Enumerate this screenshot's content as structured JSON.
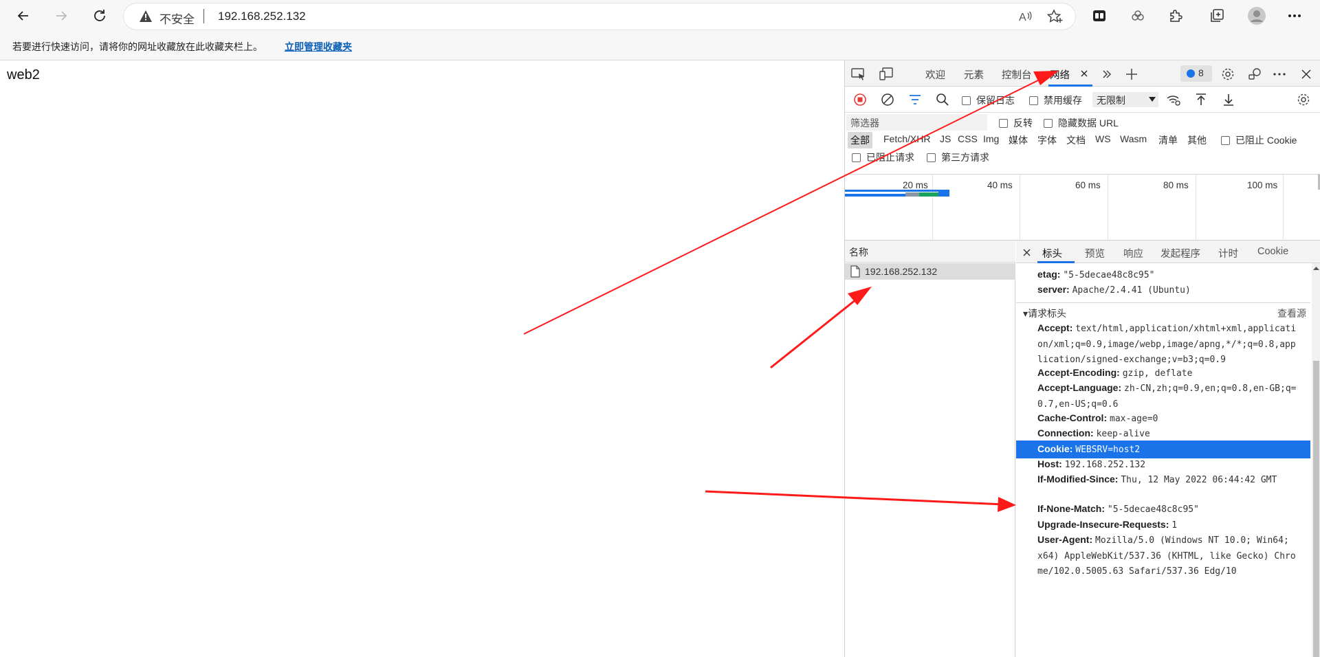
{
  "browser": {
    "insecure_label": "不安全",
    "url": "192.168.252.132",
    "favorites_msg": "若要进行快速访问，请将你的网址收藏放在此收藏夹栏上。",
    "favorites_link": "立即管理收藏夹"
  },
  "page": {
    "heading": "web2"
  },
  "devtools": {
    "tabs": {
      "welcome": "欢迎",
      "elements": "元素",
      "console": "控制台",
      "network": "网络"
    },
    "message_count": "8",
    "toolbar": {
      "preserve_log": "保留日志",
      "disable_cache": "禁用缓存",
      "throttle": "无限制"
    },
    "filter": {
      "placeholder": "筛选器",
      "invert": "反转",
      "hide_data_urls": "隐藏数据 URL",
      "types": [
        "全部",
        "Fetch/XHR",
        "JS",
        "CSS",
        "Img",
        "媒体",
        "字体",
        "文档",
        "WS",
        "Wasm",
        "清单",
        "其他"
      ],
      "blocked_cookies": "已阻止 Cookie",
      "blocked_requests": "已阻止请求",
      "third_party": "第三方请求"
    },
    "timeline": {
      "ticks": [
        "20 ms",
        "40 ms",
        "60 ms",
        "80 ms",
        "100 ms"
      ]
    },
    "request_list": {
      "header": "名称",
      "rows": [
        "192.168.252.132"
      ]
    },
    "detail": {
      "tabs": [
        "标头",
        "预览",
        "响应",
        "发起程序",
        "计时",
        "Cookie"
      ],
      "response_headers": [
        {
          "k": "etag",
          "v": "\"5-5decae48c8c95\""
        },
        {
          "k": "server",
          "v": "Apache/2.4.41 (Ubuntu)"
        }
      ],
      "request_section": "▾请求标头",
      "view_source": "查看源",
      "request_headers": [
        {
          "k": "Accept",
          "v": "text/html,application/xhtml+xml,application/xml;q=0.9,image/webp,image/apng,*/*;q=0.8,application/signed-exchange;v=b3;q=0.9"
        },
        {
          "k": "Accept-Encoding",
          "v": "gzip, deflate"
        },
        {
          "k": "Accept-Language",
          "v": "zh-CN,zh;q=0.9,en;q=0.8,en-GB;q=0.7,en-US;q=0.6"
        },
        {
          "k": "Cache-Control",
          "v": "max-age=0"
        },
        {
          "k": "Connection",
          "v": "keep-alive"
        },
        {
          "k": "Cookie",
          "v": "WEBSRV=host2"
        },
        {
          "k": "Host",
          "v": "192.168.252.132"
        },
        {
          "k": "If-Modified-Since",
          "v": "Thu, 12 May 2022 06:44:42 GMT"
        },
        {
          "k": "If-None-Match",
          "v": "\"5-5decae48c8c95\""
        },
        {
          "k": "Upgrade-Insecure-Requests",
          "v": "1"
        },
        {
          "k": "User-Agent",
          "v": "Mozilla/5.0 (Windows NT 10.0; Win64; x64) AppleWebKit/537.36 (KHTML, like Gecko) Chrome/102.0.5005.63 Safari/537.36 Edg/10"
        }
      ]
    }
  },
  "colors": {
    "accent": "#1a73e8",
    "arrow": "#ff1a1a",
    "record": "#e53935"
  }
}
